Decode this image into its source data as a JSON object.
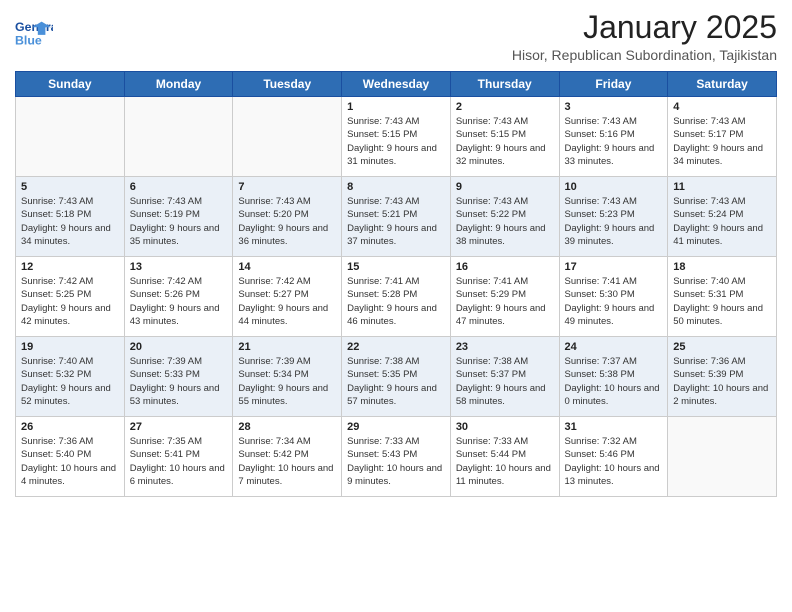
{
  "logo": {
    "line1": "General",
    "line2": "Blue"
  },
  "title": "January 2025",
  "subtitle": "Hisor, Republican Subordination, Tajikistan",
  "days_header": [
    "Sunday",
    "Monday",
    "Tuesday",
    "Wednesday",
    "Thursday",
    "Friday",
    "Saturday"
  ],
  "weeks": [
    {
      "shaded": false,
      "days": [
        {
          "num": "",
          "info": ""
        },
        {
          "num": "",
          "info": ""
        },
        {
          "num": "",
          "info": ""
        },
        {
          "num": "1",
          "info": "Sunrise: 7:43 AM\nSunset: 5:15 PM\nDaylight: 9 hours\nand 31 minutes."
        },
        {
          "num": "2",
          "info": "Sunrise: 7:43 AM\nSunset: 5:15 PM\nDaylight: 9 hours\nand 32 minutes."
        },
        {
          "num": "3",
          "info": "Sunrise: 7:43 AM\nSunset: 5:16 PM\nDaylight: 9 hours\nand 33 minutes."
        },
        {
          "num": "4",
          "info": "Sunrise: 7:43 AM\nSunset: 5:17 PM\nDaylight: 9 hours\nand 34 minutes."
        }
      ]
    },
    {
      "shaded": true,
      "days": [
        {
          "num": "5",
          "info": "Sunrise: 7:43 AM\nSunset: 5:18 PM\nDaylight: 9 hours\nand 34 minutes."
        },
        {
          "num": "6",
          "info": "Sunrise: 7:43 AM\nSunset: 5:19 PM\nDaylight: 9 hours\nand 35 minutes."
        },
        {
          "num": "7",
          "info": "Sunrise: 7:43 AM\nSunset: 5:20 PM\nDaylight: 9 hours\nand 36 minutes."
        },
        {
          "num": "8",
          "info": "Sunrise: 7:43 AM\nSunset: 5:21 PM\nDaylight: 9 hours\nand 37 minutes."
        },
        {
          "num": "9",
          "info": "Sunrise: 7:43 AM\nSunset: 5:22 PM\nDaylight: 9 hours\nand 38 minutes."
        },
        {
          "num": "10",
          "info": "Sunrise: 7:43 AM\nSunset: 5:23 PM\nDaylight: 9 hours\nand 39 minutes."
        },
        {
          "num": "11",
          "info": "Sunrise: 7:43 AM\nSunset: 5:24 PM\nDaylight: 9 hours\nand 41 minutes."
        }
      ]
    },
    {
      "shaded": false,
      "days": [
        {
          "num": "12",
          "info": "Sunrise: 7:42 AM\nSunset: 5:25 PM\nDaylight: 9 hours\nand 42 minutes."
        },
        {
          "num": "13",
          "info": "Sunrise: 7:42 AM\nSunset: 5:26 PM\nDaylight: 9 hours\nand 43 minutes."
        },
        {
          "num": "14",
          "info": "Sunrise: 7:42 AM\nSunset: 5:27 PM\nDaylight: 9 hours\nand 44 minutes."
        },
        {
          "num": "15",
          "info": "Sunrise: 7:41 AM\nSunset: 5:28 PM\nDaylight: 9 hours\nand 46 minutes."
        },
        {
          "num": "16",
          "info": "Sunrise: 7:41 AM\nSunset: 5:29 PM\nDaylight: 9 hours\nand 47 minutes."
        },
        {
          "num": "17",
          "info": "Sunrise: 7:41 AM\nSunset: 5:30 PM\nDaylight: 9 hours\nand 49 minutes."
        },
        {
          "num": "18",
          "info": "Sunrise: 7:40 AM\nSunset: 5:31 PM\nDaylight: 9 hours\nand 50 minutes."
        }
      ]
    },
    {
      "shaded": true,
      "days": [
        {
          "num": "19",
          "info": "Sunrise: 7:40 AM\nSunset: 5:32 PM\nDaylight: 9 hours\nand 52 minutes."
        },
        {
          "num": "20",
          "info": "Sunrise: 7:39 AM\nSunset: 5:33 PM\nDaylight: 9 hours\nand 53 minutes."
        },
        {
          "num": "21",
          "info": "Sunrise: 7:39 AM\nSunset: 5:34 PM\nDaylight: 9 hours\nand 55 minutes."
        },
        {
          "num": "22",
          "info": "Sunrise: 7:38 AM\nSunset: 5:35 PM\nDaylight: 9 hours\nand 57 minutes."
        },
        {
          "num": "23",
          "info": "Sunrise: 7:38 AM\nSunset: 5:37 PM\nDaylight: 9 hours\nand 58 minutes."
        },
        {
          "num": "24",
          "info": "Sunrise: 7:37 AM\nSunset: 5:38 PM\nDaylight: 10 hours\nand 0 minutes."
        },
        {
          "num": "25",
          "info": "Sunrise: 7:36 AM\nSunset: 5:39 PM\nDaylight: 10 hours\nand 2 minutes."
        }
      ]
    },
    {
      "shaded": false,
      "days": [
        {
          "num": "26",
          "info": "Sunrise: 7:36 AM\nSunset: 5:40 PM\nDaylight: 10 hours\nand 4 minutes."
        },
        {
          "num": "27",
          "info": "Sunrise: 7:35 AM\nSunset: 5:41 PM\nDaylight: 10 hours\nand 6 minutes."
        },
        {
          "num": "28",
          "info": "Sunrise: 7:34 AM\nSunset: 5:42 PM\nDaylight: 10 hours\nand 7 minutes."
        },
        {
          "num": "29",
          "info": "Sunrise: 7:33 AM\nSunset: 5:43 PM\nDaylight: 10 hours\nand 9 minutes."
        },
        {
          "num": "30",
          "info": "Sunrise: 7:33 AM\nSunset: 5:44 PM\nDaylight: 10 hours\nand 11 minutes."
        },
        {
          "num": "31",
          "info": "Sunrise: 7:32 AM\nSunset: 5:46 PM\nDaylight: 10 hours\nand 13 minutes."
        },
        {
          "num": "",
          "info": ""
        }
      ]
    }
  ]
}
